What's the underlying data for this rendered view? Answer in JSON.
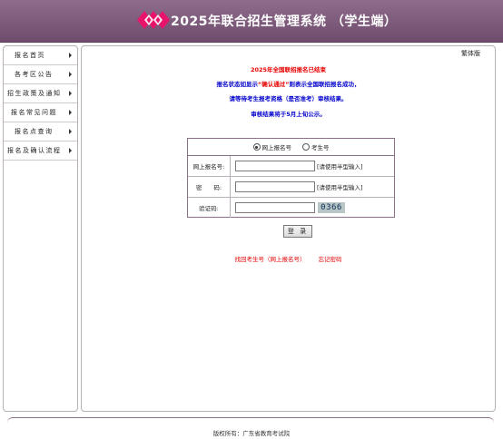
{
  "header": {
    "title": "2025年联合招生管理系统 （学生端）",
    "logo_icon": "diamond-logo-icon"
  },
  "sidebar": {
    "items": [
      {
        "label": "报名首页"
      },
      {
        "label": "各考区公告"
      },
      {
        "label": "招生政策及通知"
      },
      {
        "label": "报名常见问题"
      },
      {
        "label": "报名点查询"
      },
      {
        "label": "报名及确认流程"
      }
    ]
  },
  "main": {
    "lang_toggle": "繁体版",
    "notices": {
      "line1": "2025年全国联招报名已结束",
      "line2_pre": "报名状态如显示",
      "line2_quote": "“确认通过”",
      "line2_post": "则表示全国联招报名成功，",
      "line3": "请等待考生报考资格（是否准考）审核结果。",
      "line4": "审核结果将于5月上旬公示。"
    },
    "login_type": {
      "option1": "网上报名号",
      "option2": "考生号",
      "selected": "网上报名号"
    },
    "form": {
      "reg_label": "网上报名号:",
      "reg_value": "",
      "reg_hint": "[请使用半型输入]",
      "pwd_label": "密　　码:",
      "pwd_value": "",
      "pwd_hint": "[请使用半型输入]",
      "captcha_label": "验证码:",
      "captcha_value": "",
      "captcha_text": "0366"
    },
    "login_button": "登 录",
    "links": {
      "recover_id": "找回考生号（网上报名号）",
      "forgot_pwd": "忘记密码"
    }
  },
  "footer": {
    "copyright": "版权所有：广东省教育考试院"
  },
  "colors": {
    "header_bg": "#7a5778",
    "notice_red": "#e60000",
    "notice_blue": "#0000cc",
    "logo_pink": "#e8146b"
  }
}
